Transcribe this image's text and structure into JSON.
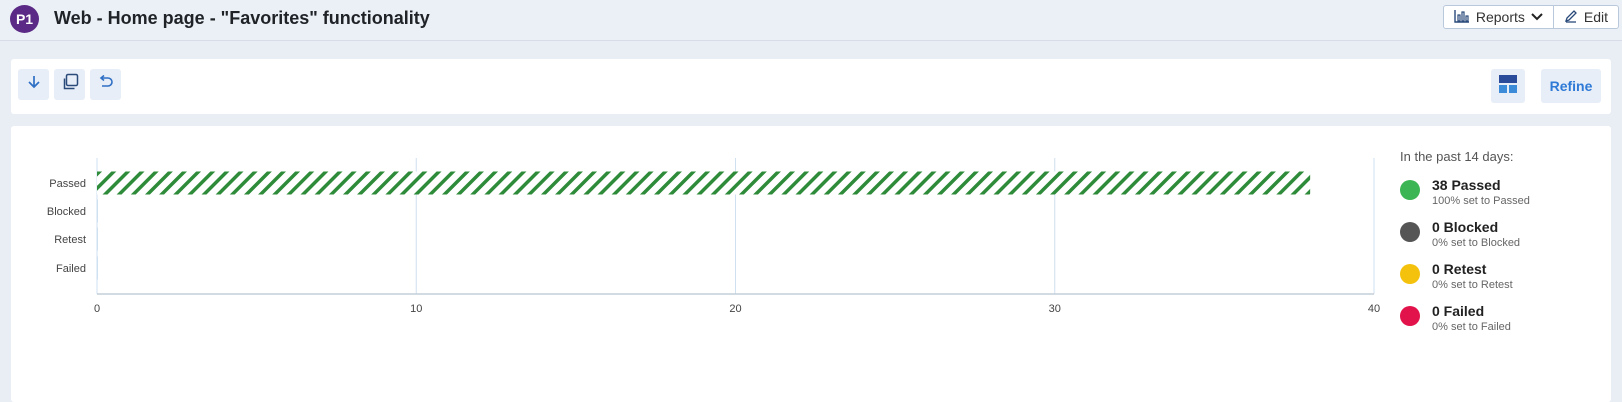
{
  "header": {
    "badge": "P1",
    "title": "Web - Home page - \"Favorites\" functionality",
    "reports_label": "Reports",
    "edit_label": "Edit"
  },
  "toolbar": {
    "refine_label": "Refine"
  },
  "chart_data": {
    "type": "bar",
    "orientation": "horizontal",
    "categories": [
      "Passed",
      "Blocked",
      "Retest",
      "Failed"
    ],
    "values": [
      38,
      0,
      0,
      0
    ],
    "xlim": [
      0,
      40
    ],
    "x_ticks": [
      0,
      10,
      20,
      30,
      40
    ],
    "grid": true,
    "colors": [
      "#2e8b3a"
    ],
    "bar_pattern": "diagonal-hatch"
  },
  "legend": {
    "title": "In the past 14 days:",
    "items": [
      {
        "count": "38 Passed",
        "sub": "100% set to Passed",
        "color": "#3cb554"
      },
      {
        "count": "0 Blocked",
        "sub": "0% set to Blocked",
        "color": "#555555"
      },
      {
        "count": "0 Retest",
        "sub": "0% set to Retest",
        "color": "#f4c20d"
      },
      {
        "count": "0 Failed",
        "sub": "0% set to Failed",
        "color": "#e2124a"
      }
    ]
  },
  "icons": {
    "download": "arrow-down-icon",
    "copy": "copy-icon",
    "reset": "undo-icon",
    "layout": "layout-icon",
    "chart": "bar-chart-icon",
    "edit": "pencil-icon",
    "dropdown": "chevron-down-icon"
  }
}
